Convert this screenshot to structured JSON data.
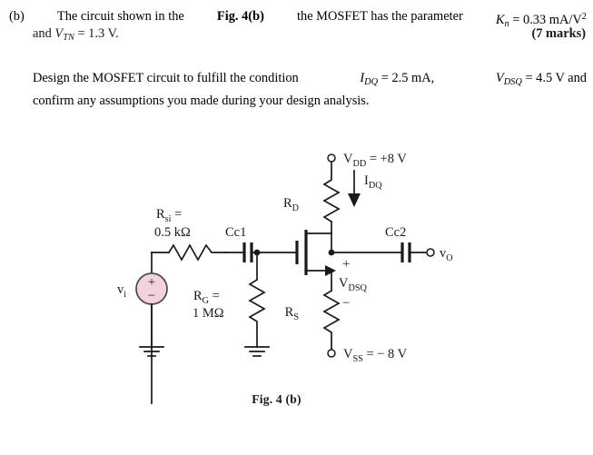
{
  "question": {
    "label": "(b)",
    "line1_pre": "The circuit shown in the ",
    "line1_figref": "Fig. 4(b)",
    "line1_mid": " the MOSFET has the parameter ",
    "line1_kn": "K",
    "line1_kn_sub": "n",
    "line1_kn_val": " = 0.33 mA/V",
    "line1_kn_sup": "2",
    "line2_and": "and ",
    "line2_v": "V",
    "line2_v_sub": "TN",
    "line2_v_val": " = 1.3 V.",
    "marks": "(7 marks)",
    "p2_pre": "Design the MOSFET circuit to fulfill the condition ",
    "p2_i": "I",
    "p2_i_sub": "DQ",
    "p2_i_val": " = 2.5 mA,",
    "p2_v": "V",
    "p2_v_sub": "DSQ",
    "p2_v_val": " = 4.5 V and",
    "p2_line2": "confirm any assumptions you made during your design analysis."
  },
  "figure": {
    "caption": "Fig. 4 (b)",
    "source_label": "v",
    "source_label_sub": "i",
    "source_plus": "+",
    "source_minus": "−",
    "rsi_label": "R",
    "rsi_label_sub": "si",
    "rsi_eq": " =",
    "rsi_value": "0.5 kΩ",
    "cc1_label": "Cc1",
    "rg_label": "R",
    "rg_label_sub": "G",
    "rg_eq": " =",
    "rg_value": "1 MΩ",
    "rd_label": "R",
    "rd_label_sub": "D",
    "rs_label": "R",
    "rs_label_sub": "S",
    "vdd_label": "V",
    "vdd_label_sub": "DD",
    "vdd_value": " = +8 V",
    "vss_label": "V",
    "vss_label_sub": "SS",
    "vss_value": " = − 8 V",
    "idq_label": "I",
    "idq_label_sub": "DQ",
    "vdsq_label": "V",
    "vdsq_label_sub": "DSQ",
    "vdsq_plus": "+",
    "vdsq_minus": "−",
    "cc2_label": "Cc2",
    "vo_label": "v",
    "vo_label_sub": "O"
  },
  "colors": {
    "ink": "#1a1a1a",
    "source_fill": "#f2d2de",
    "paper": "#ffffff"
  }
}
